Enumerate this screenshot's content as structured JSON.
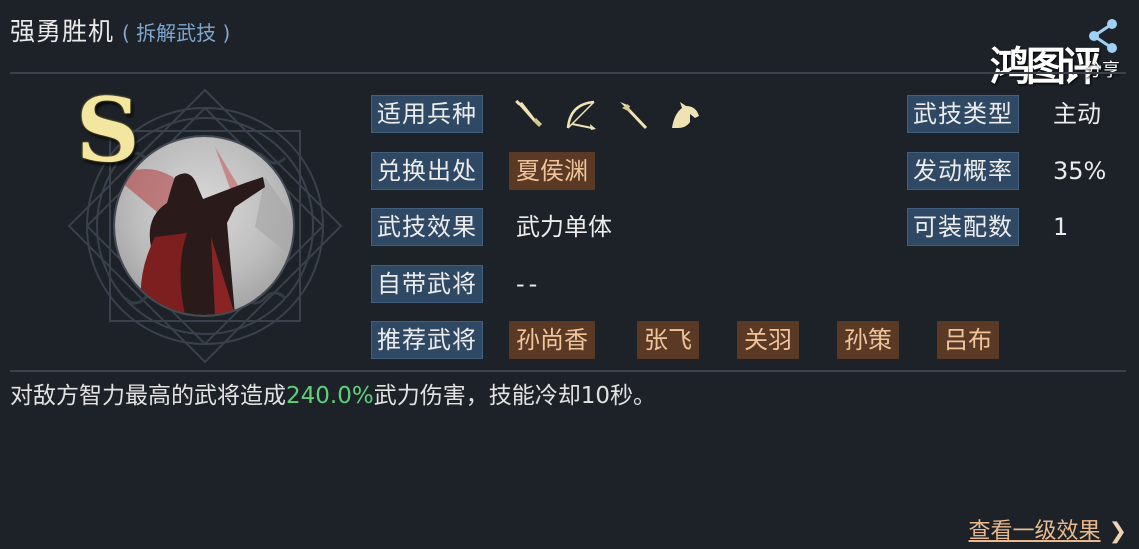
{
  "header": {
    "title": "强勇胜机",
    "subtitle": "( 拆解武技 )"
  },
  "watermark": {
    "brand": "鸿图评",
    "share": "分享"
  },
  "skill": {
    "grade": "S",
    "fields": {
      "troop_type_label": "适用兵种",
      "troop_icons": [
        "sword-icon",
        "bow-icon",
        "spear-icon",
        "horse-icon"
      ],
      "source_label": "兑换出处",
      "source_value": "夏侯渊",
      "effect_label": "武技效果",
      "effect_value": "武力单体",
      "own_general_label": "自带武将",
      "own_general_value": "--",
      "recommended_label": "推荐武将",
      "recommended": [
        "孙尚香",
        "张飞",
        "关羽",
        "孙策",
        "吕布"
      ],
      "type_label": "武技类型",
      "type_value": "主动",
      "chance_label": "发动概率",
      "chance_value": "35%",
      "slots_label": "可装配数",
      "slots_value": "1"
    },
    "description": {
      "prefix": "对敌方智力最高的武将造成",
      "highlight": "240.0%",
      "suffix": "武力伤害，技能冷却10秒。"
    }
  },
  "footer": {
    "more_link": "查看一级效果",
    "more_arrow": "❯"
  },
  "colors": {
    "background": "#1d2229",
    "label_bg": "#2f4964",
    "tag_bg": "#5b3a25",
    "tag_text": "#f0c39b",
    "highlight": "#5fcf7c",
    "subtitle": "#7fa7cf",
    "grade": "#f3e6a0"
  }
}
